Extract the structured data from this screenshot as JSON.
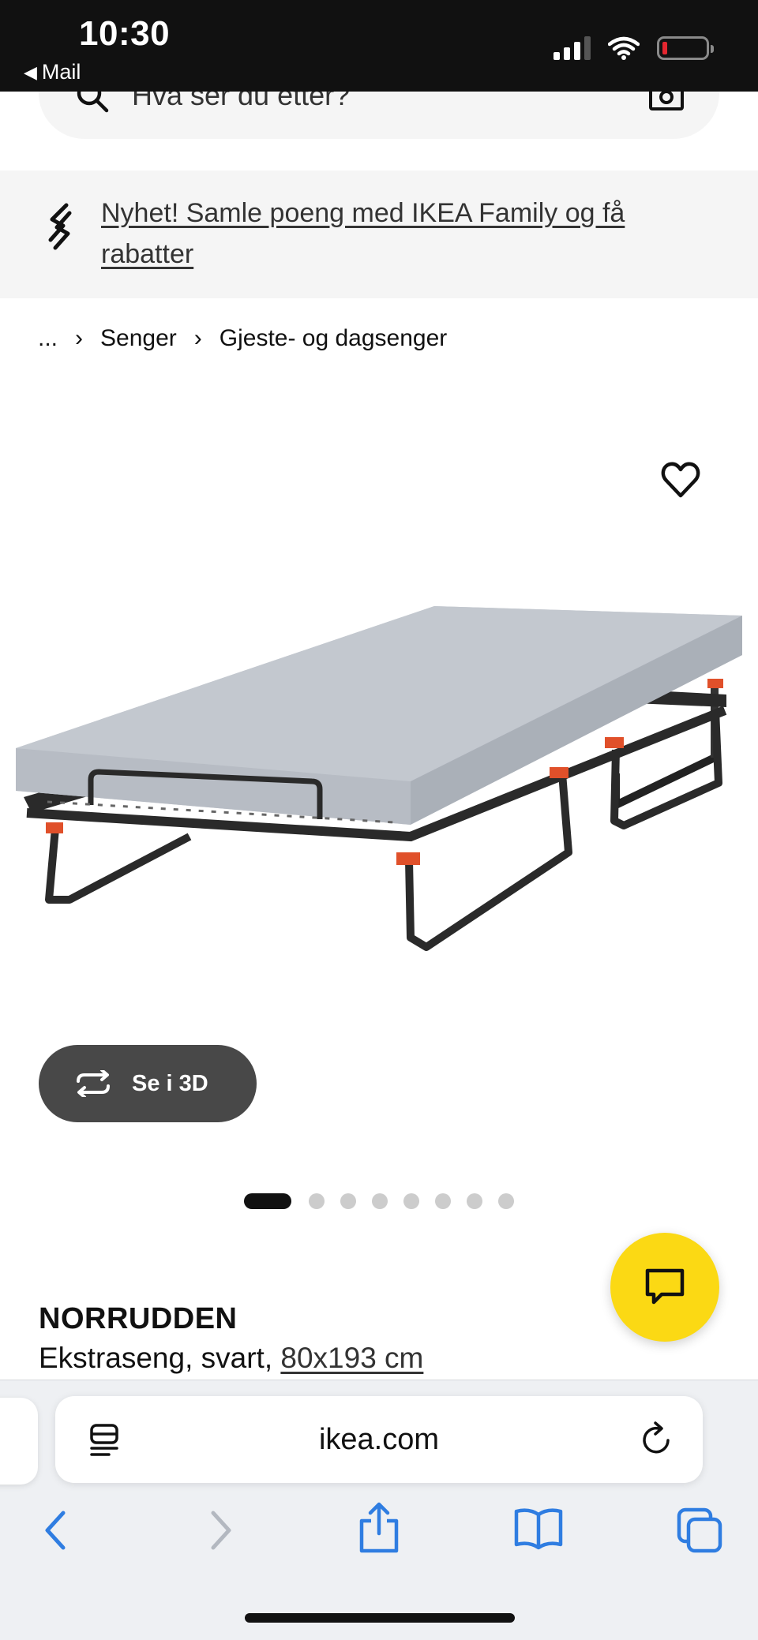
{
  "status_bar": {
    "time": "10:30",
    "back_label": "Mail",
    "back_glyph": "◀",
    "icons": [
      "signal-icon",
      "wifi-icon",
      "battery-low-icon"
    ]
  },
  "search": {
    "placeholder": "Hva ser du etter?",
    "icons": [
      "search-icon",
      "camera-icon"
    ]
  },
  "promo": {
    "text": "Nyhet! Samle poeng med IKEA Family og få rabatter",
    "icon": "link-icon"
  },
  "breadcrumb": {
    "items": [
      "...",
      "Senger",
      "Gjeste- og dagsenger"
    ],
    "separator": "›"
  },
  "product": {
    "image_icon": "folding-bed-image",
    "wishlist_icon": "heart-icon",
    "view_3d_label": "Se i 3D",
    "carousel": {
      "total": 8,
      "active": 1
    },
    "name": "NORRUDDEN",
    "description": "Ekstraseng, svart, ",
    "size_link": "80x193 cm"
  },
  "chat": {
    "icon": "chat-icon"
  },
  "colors": {
    "ikea_yellow": "#fbd914",
    "button_dark": "#484848",
    "banner_bg": "#f5f5f5",
    "safari_blue": "#2f7de1"
  },
  "browser": {
    "url": "ikea.com",
    "icons": [
      "reader-icon",
      "reload-icon",
      "back-icon",
      "forward-icon",
      "share-icon",
      "bookmarks-icon",
      "tabs-icon"
    ]
  }
}
